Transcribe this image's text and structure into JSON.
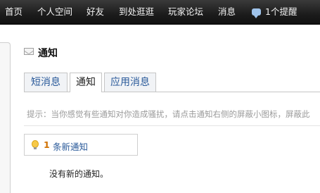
{
  "nav": {
    "items": [
      "首页",
      "个人空间",
      "好友",
      "到处逛逛",
      "玩家论坛",
      "消息"
    ],
    "reminder_label": "1个提醒"
  },
  "page": {
    "title": "通知"
  },
  "tabs": [
    "短消息",
    "通知",
    "应用消息"
  ],
  "active_tab": "通知",
  "hint": "提示：当你感觉有些通知对你造成骚扰，请点击通知右侧的屏蔽小图标，屏蔽此",
  "notice": {
    "count": "1",
    "label": "条新通知"
  },
  "empty_message": "没有新的通知。",
  "colors": {
    "nav_bg": "#1c1c1c",
    "link": "#2a5a9a",
    "count": "#d07000"
  }
}
